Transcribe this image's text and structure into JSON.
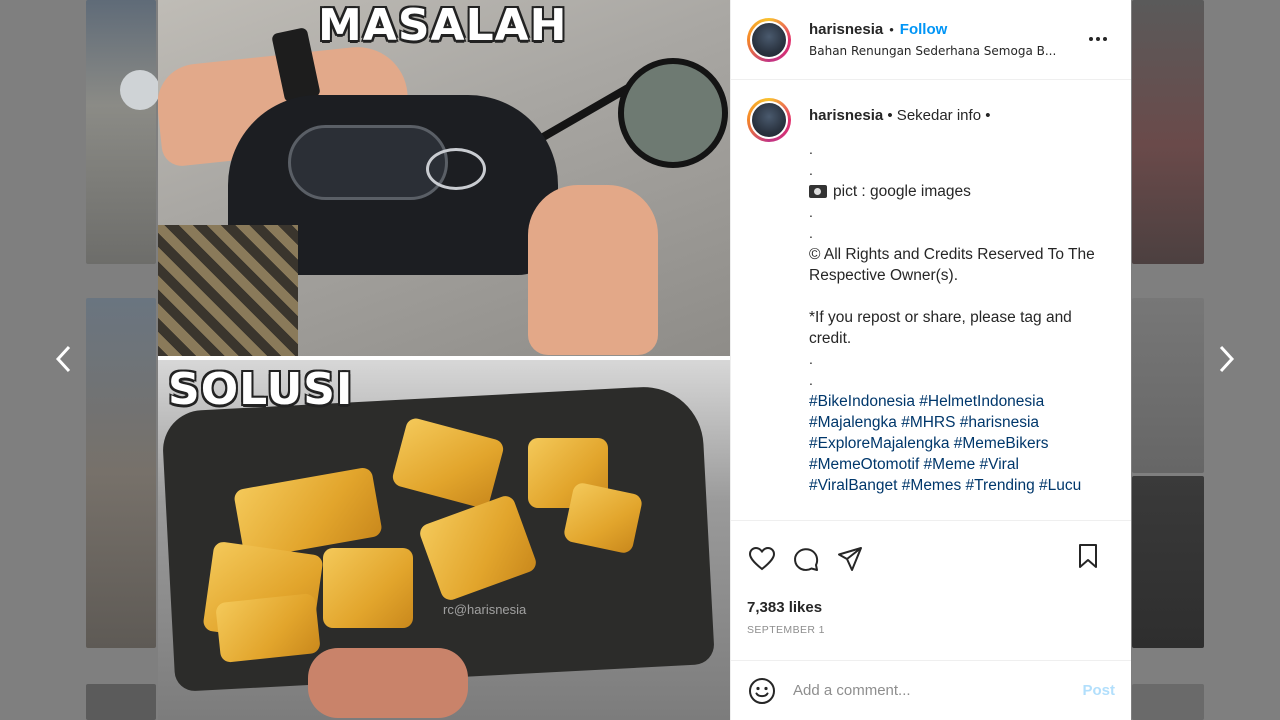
{
  "media": {
    "top_label": "MASALAH",
    "bottom_label": "SOLUSI",
    "watermark": "rc@harisnesia"
  },
  "header": {
    "username": "harisnesia",
    "separator": "•",
    "follow_label": "Follow",
    "subtitle": "Bahan Renungan Sederhana Semoga B..."
  },
  "caption": {
    "username": "harisnesia",
    "title": "• Sekedar info •",
    "lines": [
      ".",
      ".",
      "pict : google images",
      ".",
      ".",
      "© All Rights and Credits Reserved To The",
      "Respective Owner(s).",
      "",
      "*If you repost or share, please tag and",
      "credit.",
      ".",
      "."
    ],
    "hashtags": [
      "#BikeIndonesia #HelmetIndonesia",
      "#Majalengka #MHRS #harisnesia",
      "#ExploreMajalengka #MemeBikers",
      "#MemeOtomotif #Meme #Viral",
      "#ViralBanget #Memes #Trending #Lucu"
    ]
  },
  "stats": {
    "likes": "7,383 likes",
    "date": "SEPTEMBER 1"
  },
  "comment_box": {
    "placeholder": "Add a comment...",
    "post_label": "Post"
  },
  "icons": {
    "like": "heart-icon",
    "comment": "comment-icon",
    "share": "paper-plane-icon",
    "save": "bookmark-icon",
    "emoji": "smiley-icon",
    "more": "ellipsis-icon",
    "prev": "chevron-left-icon",
    "next": "chevron-right-icon"
  },
  "colors": {
    "follow": "#0095f6",
    "hashtag": "#00376b",
    "post_disabled": "#b2dffc",
    "overlay": "#7f7f7f"
  }
}
